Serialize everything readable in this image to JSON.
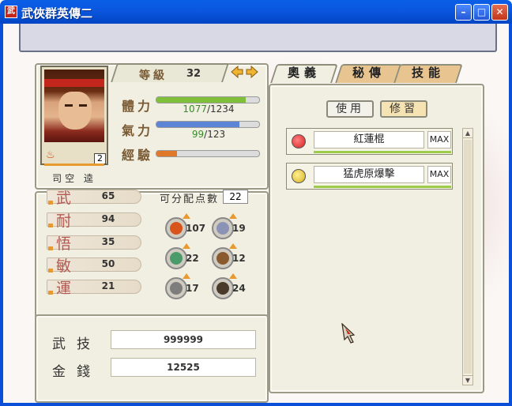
{
  "window": {
    "title": "武俠群英傳二",
    "app_icon_text": "武",
    "buttons": {
      "minimize": "–",
      "maximize": "□",
      "close": "✕"
    }
  },
  "character": {
    "name": "司空 逵",
    "level_label": "等級",
    "level": "32",
    "portrait_level": "2",
    "hp_label": "體力",
    "hp_current": "1077",
    "hp_max": "/1234",
    "hp_fraction": 0.873,
    "mp_label": "氣力",
    "mp_current": "99",
    "mp_max": "/123",
    "mp_fraction": 0.805,
    "exp_label": "經驗",
    "exp_fraction": 0.2
  },
  "stats": [
    {
      "label": "武",
      "value": "65"
    },
    {
      "label": "耐",
      "value": "94"
    },
    {
      "label": "悟",
      "value": "35"
    },
    {
      "label": "敏",
      "value": "50"
    },
    {
      "label": "運",
      "value": "21"
    }
  ],
  "points": {
    "label": "可分配点數",
    "value": "22"
  },
  "elements": [
    {
      "icon": "fire-element-icon",
      "value": "107",
      "color": "#d9541a"
    },
    {
      "icon": "wind-element-icon",
      "value": "19",
      "color": "#8a93b6"
    },
    {
      "icon": "tornado-element-icon",
      "value": "22",
      "color": "#4a9a6a"
    },
    {
      "icon": "earth-element-icon",
      "value": "12",
      "color": "#8a5a2e"
    },
    {
      "icon": "blade-element-icon",
      "value": "17",
      "color": "#7d7d7d"
    },
    {
      "icon": "bull-element-icon",
      "value": "24",
      "color": "#4a3a2a"
    }
  ],
  "money": {
    "skill_label": "武技",
    "skill_value": "999999",
    "gold_label": "金錢",
    "gold_value": "12525"
  },
  "tabs": [
    {
      "label": "奧義",
      "active": true
    },
    {
      "label": "秘傳",
      "active": false
    },
    {
      "label": "技能",
      "active": false
    }
  ],
  "actions": {
    "use": "使用",
    "train": "修習"
  },
  "skills": [
    {
      "name": "紅蓮棍",
      "max": "MAX",
      "icon": "red-orb-icon",
      "color": "#d82020"
    },
    {
      "name": "猛虎原爆擊",
      "max": "MAX",
      "icon": "gold-orb-icon",
      "color": "#d8b020"
    }
  ],
  "colors": {
    "hp_bar": "#7fbf3a",
    "mp_bar": "#5d85d6",
    "exp_bar": "#e0782a",
    "accent": "#e79a2f"
  }
}
